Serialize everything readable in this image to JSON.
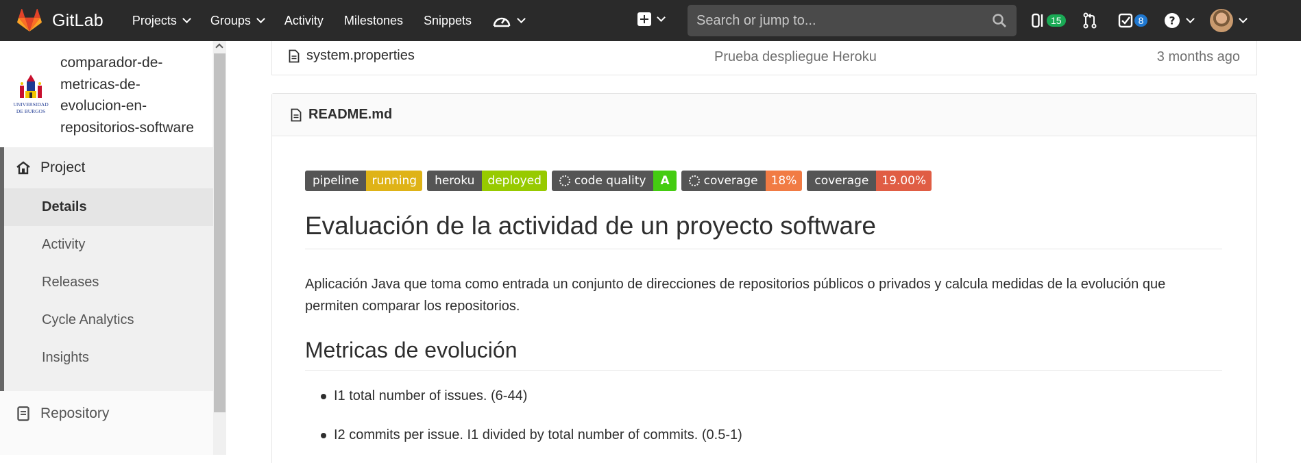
{
  "navbar": {
    "brand": "GitLab",
    "links": [
      {
        "label": "Projects",
        "dropdown": true
      },
      {
        "label": "Groups",
        "dropdown": true
      },
      {
        "label": "Activity",
        "dropdown": false
      },
      {
        "label": "Milestones",
        "dropdown": false
      },
      {
        "label": "Snippets",
        "dropdown": false
      }
    ],
    "search_placeholder": "Search or jump to...",
    "issues_count": "15",
    "todos_count": "8"
  },
  "sidebar": {
    "project_name": "comparador-de-metricas-de-evolucion-en-repositorios-software",
    "project_name_lines": [
      "comparador-de-",
      "metricas-de-",
      "evolucion-en-",
      "repositorios-software"
    ],
    "section": "Project",
    "items": [
      "Details",
      "Activity",
      "Releases",
      "Cycle Analytics",
      "Insights"
    ],
    "active_item": "Details",
    "repository": "Repository"
  },
  "file_row": {
    "name": "system.properties",
    "commit": "Prueba despliegue Heroku",
    "time": "3 months ago"
  },
  "readme": {
    "filename": "README.md",
    "badges": [
      {
        "left": "pipeline",
        "right": "running",
        "color": "#dfb317",
        "spinner": false
      },
      {
        "left": "heroku",
        "right": "deployed",
        "color": "#97ca00",
        "spinner": false
      },
      {
        "left": "code quality",
        "right": "A",
        "color": "#4c1",
        "spinner": true
      },
      {
        "left": "coverage",
        "right": "18%",
        "color": "#e05d44",
        "spinner": true
      },
      {
        "left": "coverage",
        "right": "19.00%",
        "color": "#e05d44",
        "spinner": false
      }
    ],
    "h1": "Evaluación de la actividad de un proyecto software",
    "paragraph": "Aplicación Java que toma como entrada un conjunto de direcciones de repositorios públicos o privados y calcula medidas de la evolución que permiten comparar los repositorios.",
    "h2": "Metricas de evolución",
    "list": [
      "I1 total number of issues. (6-44)",
      "I2 commits per issue. I1 divided by total number of commits. (0.5-1)"
    ]
  },
  "colors": {
    "navbar_bg": "#2a2a2a",
    "gitlab_orange": "#e24329",
    "issues_badge": "#1aaa55",
    "todos_badge": "#1f78d1"
  }
}
